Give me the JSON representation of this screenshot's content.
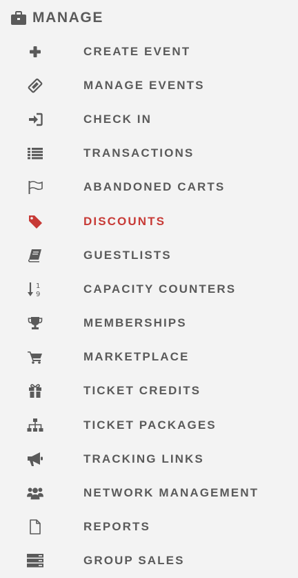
{
  "section": {
    "title": "MANAGE",
    "icon": "briefcase-icon"
  },
  "colors": {
    "text": "#5a5a5a",
    "active": "#c73a36",
    "background": "#f3f3f3"
  },
  "nav": {
    "items": [
      {
        "label": "CREATE EVENT",
        "icon": "plus-icon",
        "active": false
      },
      {
        "label": "MANAGE EVENTS",
        "icon": "ticket-icon",
        "active": false
      },
      {
        "label": "CHECK IN",
        "icon": "sign-in-icon",
        "active": false
      },
      {
        "label": "TRANSACTIONS",
        "icon": "list-icon",
        "active": false
      },
      {
        "label": "ABANDONED CARTS",
        "icon": "flag-icon",
        "active": false
      },
      {
        "label": "DISCOUNTS",
        "icon": "tag-icon",
        "active": true
      },
      {
        "label": "GUESTLISTS",
        "icon": "book-icon",
        "active": false
      },
      {
        "label": "CAPACITY COUNTERS",
        "icon": "sort-numeric-icon",
        "active": false
      },
      {
        "label": "MEMBERSHIPS",
        "icon": "trophy-icon",
        "active": false
      },
      {
        "label": "MARKETPLACE",
        "icon": "cart-icon",
        "active": false
      },
      {
        "label": "TICKET CREDITS",
        "icon": "gift-icon",
        "active": false
      },
      {
        "label": "TICKET PACKAGES",
        "icon": "sitemap-icon",
        "active": false
      },
      {
        "label": "TRACKING LINKS",
        "icon": "megaphone-icon",
        "active": false
      },
      {
        "label": "NETWORK MANAGEMENT",
        "icon": "users-icon",
        "active": false
      },
      {
        "label": "REPORTS",
        "icon": "file-icon",
        "active": false
      },
      {
        "label": "GROUP SALES",
        "icon": "server-icon",
        "active": false
      }
    ]
  }
}
